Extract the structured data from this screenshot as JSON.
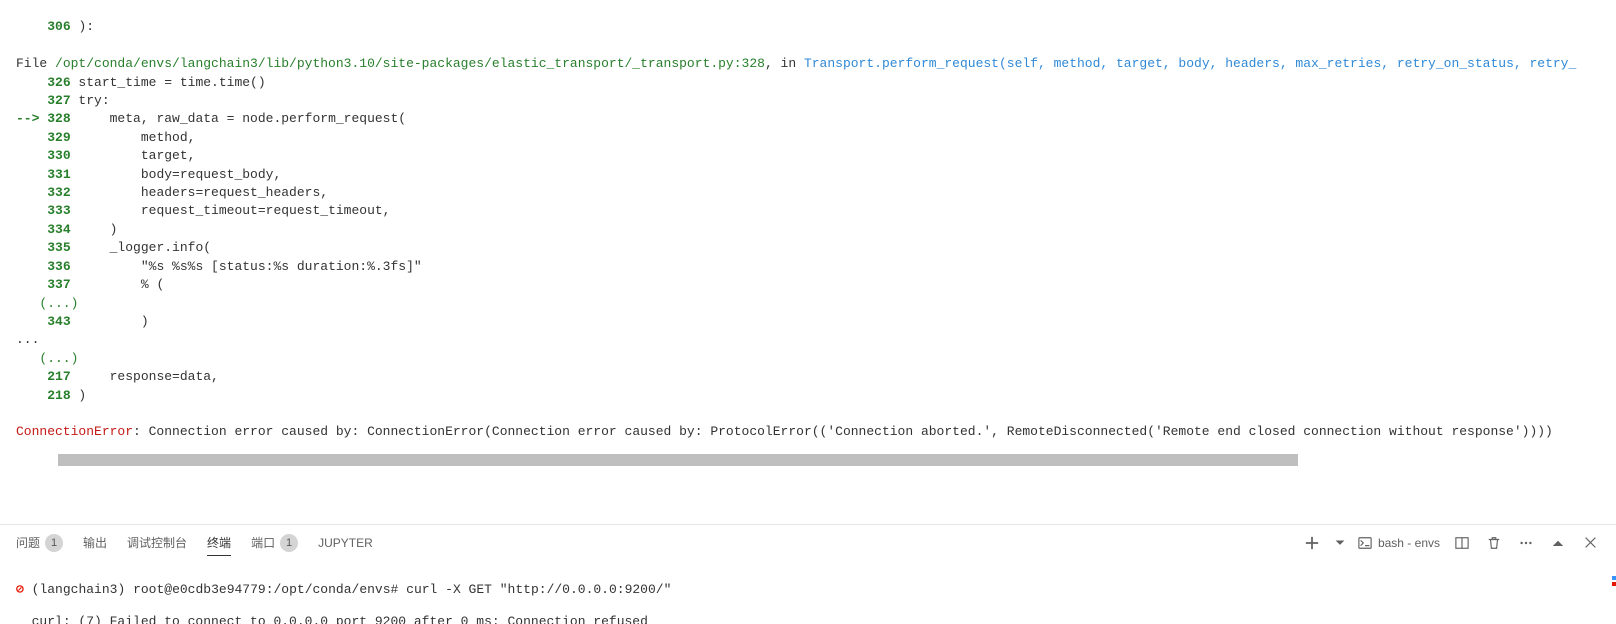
{
  "traceback": {
    "top": {
      "lineno": "306",
      "code": "):"
    },
    "file": {
      "prefix": "File ",
      "path": "/opt/conda/envs/langchain3/lib/python3.10/site-packages/elastic_transport/_transport.py:328",
      "in": ", in ",
      "func": "Transport.perform_request(self, method, target, body, headers, max_retries, retry_on_status, retry_"
    },
    "lines": [
      {
        "arrow": "    ",
        "no": "326",
        "code": " start_time = time.time()"
      },
      {
        "arrow": "    ",
        "no": "327",
        "code": " try:"
      },
      {
        "arrow": "--> ",
        "no": "328",
        "code": "     meta, raw_data = node.perform_request("
      },
      {
        "arrow": "    ",
        "no": "329",
        "code": "         method,"
      },
      {
        "arrow": "    ",
        "no": "330",
        "code": "         target,"
      },
      {
        "arrow": "    ",
        "no": "331",
        "code": "         body=request_body,"
      },
      {
        "arrow": "    ",
        "no": "332",
        "code": "         headers=request_headers,"
      },
      {
        "arrow": "    ",
        "no": "333",
        "code": "         request_timeout=request_timeout,"
      },
      {
        "arrow": "    ",
        "no": "334",
        "code": "     )"
      },
      {
        "arrow": "    ",
        "no": "335",
        "code": "     _logger.info("
      },
      {
        "arrow": "    ",
        "no": "336",
        "code": "         \"%s %s%s [status:%s duration:%.3fs]\""
      },
      {
        "arrow": "    ",
        "no": "337",
        "code": "         % ("
      }
    ],
    "dots1": "   (...)",
    "line343": {
      "no": "343",
      "code": "         )"
    },
    "ellipsis": "...",
    "dots2": "   (...)",
    "line217": {
      "no": "217",
      "code": "     response=data,"
    },
    "line218": {
      "no": "218",
      "code": " )"
    },
    "error": {
      "name": "ConnectionError",
      "msg": ": Connection error caused by: ConnectionError(Connection error caused by: ProtocolError(('Connection aborted.', RemoteDisconnected('Remote end closed connection without response'))))"
    }
  },
  "panel": {
    "tabs": {
      "problems": "问题",
      "problems_count": "1",
      "output": "输出",
      "debug_console": "调试控制台",
      "terminal": "终端",
      "ports": "端口",
      "ports_count": "1",
      "jupyter": "JUPYTER"
    },
    "right": {
      "shell_label": "bash - envs"
    }
  },
  "terminal": {
    "dot": "⊘",
    "prompt_env": "(langchain3)",
    "prompt_user": "root@e0cdb3e94779:/opt/conda/envs#",
    "command": "curl -X GET \"http://0.0.0.0:9200/\"",
    "output": "curl: (7) Failed to connect to 0.0.0.0 port 9200 after 0 ms: Connection refused"
  }
}
